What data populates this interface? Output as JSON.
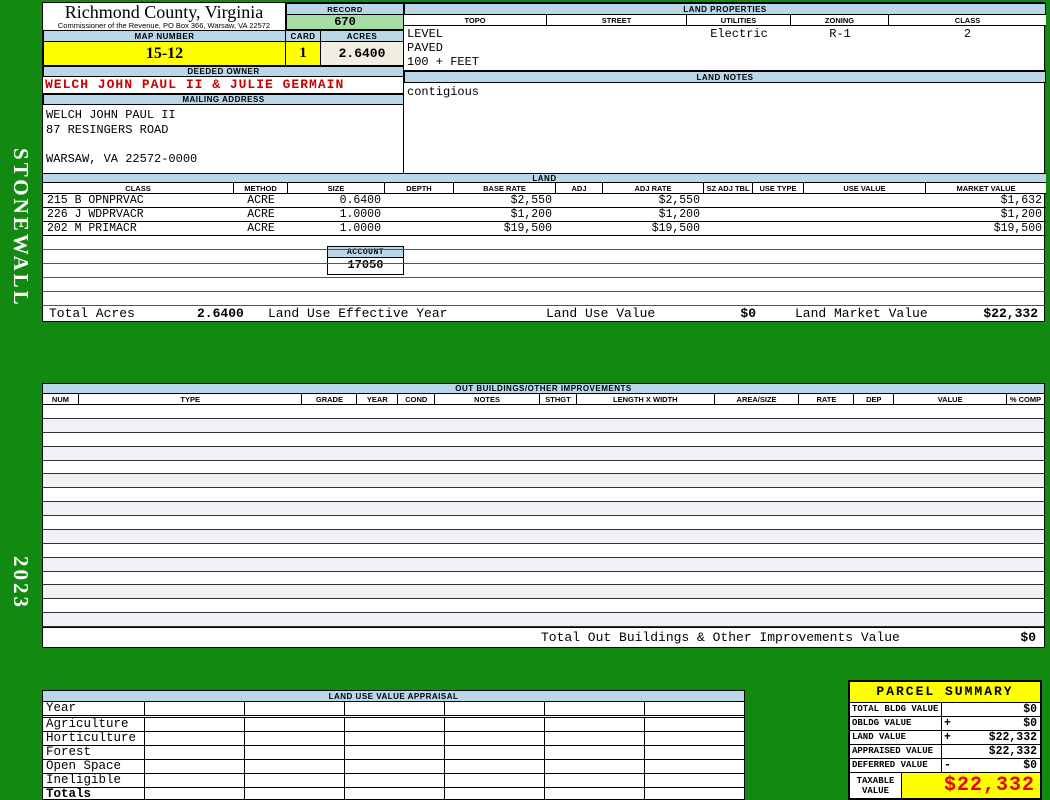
{
  "sidebar": {
    "district": "STONEWALL",
    "year": "2023"
  },
  "header": {
    "county": "Richmond County, Virginia",
    "commissioner": "Commissioner of the Revenue, PO Box 366, Warsaw, VA 22572",
    "record_label": "RECORD",
    "record_value": "670",
    "map_number_label": "MAP NUMBER",
    "map_number": "15-12",
    "card_label": "CARD",
    "card": "1",
    "acres_label": "ACRES",
    "acres": "2.6400",
    "deeded_owner_label": "DEEDED OWNER",
    "deeded_owner": "WELCH JOHN PAUL II & JULIE GERMAIN",
    "mailing_address_label": "MAILING ADDRESS",
    "mailing_address_lines": [
      "WELCH JOHN PAUL II",
      "87 RESINGERS ROAD",
      "",
      "WARSAW, VA 22572-0000"
    ],
    "account_label": "ACCOUNT",
    "account": "17050"
  },
  "land_properties": {
    "title": "LAND PROPERTIES",
    "col_topo": "TOPO",
    "col_street": "STREET",
    "col_utilities": "UTILITIES",
    "col_zoning": "ZONING",
    "col_class": "CLASS",
    "topo_line1": "LEVEL",
    "topo_line2": "PAVED",
    "topo_line3": "100 + FEET",
    "street": "",
    "utilities": "Electric",
    "zoning": "R-1",
    "class_value": "2"
  },
  "land_notes": {
    "title": "LAND NOTES",
    "text": "contigious"
  },
  "land": {
    "title": "LAND",
    "headers": {
      "class": "CLASS",
      "method": "METHOD",
      "size": "SIZE",
      "depth": "DEPTH",
      "base_rate": "BASE RATE",
      "adj": "ADJ",
      "adj_rate": "ADJ RATE",
      "sz_adj_tbl": "SZ ADJ TBL",
      "use_type": "USE TYPE",
      "use_value": "USE VALUE",
      "market_value": "MARKET VALUE"
    },
    "rows": [
      {
        "class": "215 B OPNPRVAC",
        "method": "ACRE",
        "size": "0.6400",
        "base_rate": "$2,550",
        "adj_rate": "$2,550",
        "market_value": "$1,632"
      },
      {
        "class": "226 J WDPRVACR",
        "method": "ACRE",
        "size": "1.0000",
        "base_rate": "$1,200",
        "adj_rate": "$1,200",
        "market_value": "$1,200"
      },
      {
        "class": "202 M PRIMACR",
        "method": "ACRE",
        "size": "1.0000",
        "base_rate": "$19,500",
        "adj_rate": "$19,500",
        "market_value": "$19,500"
      }
    ],
    "total_acres_label": "Total Acres",
    "total_acres": "2.6400",
    "effective_year_label": "Land Use Effective Year",
    "use_value_label": "Land Use Value",
    "use_value": "$0",
    "market_value_label": "Land Market Value",
    "market_value": "$22,332"
  },
  "out_buildings": {
    "title": "OUT BUILDINGS/OTHER IMPROVEMENTS",
    "headers": {
      "num": "NUM",
      "type": "TYPE",
      "grade": "GRADE",
      "year": "YEAR",
      "cond": "COND",
      "notes": "NOTES",
      "sthgt": "STHGT",
      "length_width": "LENGTH X WIDTH",
      "area_size": "AREA/SIZE",
      "rate": "RATE",
      "dep": "DEP",
      "value": "VALUE",
      "pct_comp": "% COMP"
    },
    "total_label": "Total Out Buildings & Other Improvements Value",
    "total_value": "$0"
  },
  "land_use_appraisal": {
    "title": "LAND USE VALUE APPRAISAL",
    "row_labels": [
      "Year",
      "Agriculture",
      "Horticulture",
      "Forest",
      "Open Space",
      "Ineligible",
      "Totals"
    ]
  },
  "parcel_summary": {
    "title": "PARCEL SUMMARY",
    "rows": [
      {
        "label": "TOTAL BLDG VALUE",
        "op": "",
        "value": "$0"
      },
      {
        "label": "OBLDG VALUE",
        "op": "+",
        "value": "$0"
      },
      {
        "label": "LAND VALUE",
        "op": "+",
        "value": "$22,332"
      },
      {
        "label": "APPRAISED VALUE",
        "op": "",
        "value": "$22,332"
      },
      {
        "label": "DEFERRED VALUE",
        "op": "-",
        "value": "$0"
      }
    ],
    "taxable_label": "TAXABLE VALUE",
    "taxable_value": "$22,332"
  },
  "colors": {
    "background_green": "#128a12",
    "header_blue": "#b9d7e8",
    "highlight_yellow": "#ffff00",
    "record_green": "#a4dea4",
    "acres_cream": "#f0efe2",
    "owner_red": "#cc0000",
    "taxable_red": "#e60000"
  }
}
